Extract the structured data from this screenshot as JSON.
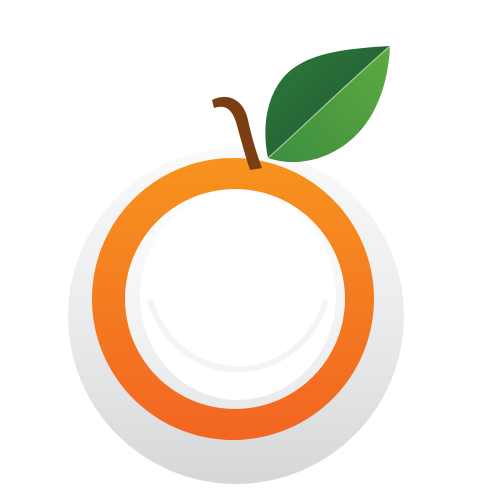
{
  "logo": {
    "name": "orange-fruit-logo",
    "colors": {
      "orange_light": "#F7931E",
      "orange_dark": "#F26522",
      "leaf_dark": "#1E5631",
      "leaf_light": "#5DAA3F",
      "stem": "#7A3E12",
      "ring_shadow_light": "#F2F2F3",
      "ring_shadow_dark": "#D6D7D9",
      "background": "#FFFFFF"
    }
  }
}
